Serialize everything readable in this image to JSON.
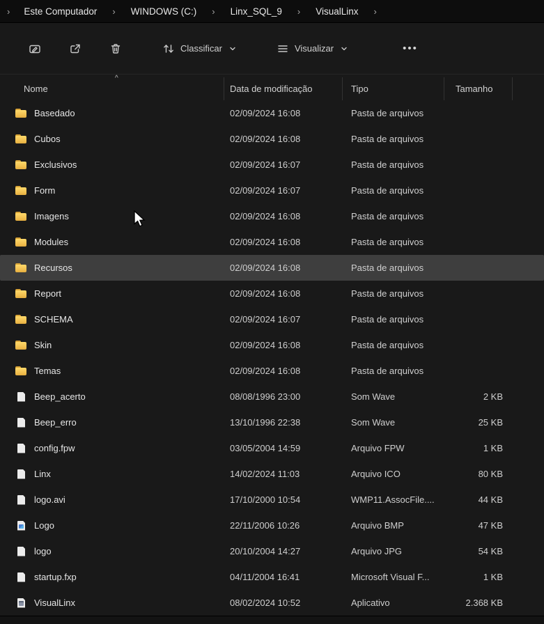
{
  "breadcrumb": {
    "separator": "›",
    "items": [
      "Este Computador",
      "WINDOWS (C:)",
      "Linx_SQL_9",
      "VisualLinx"
    ]
  },
  "toolbar": {
    "sort_label": "Classificar",
    "view_label": "Visualizar",
    "more_label": "•••"
  },
  "columns": {
    "name": "Nome",
    "date": "Data de modificação",
    "type": "Tipo",
    "size": "Tamanho",
    "sort_indicator": "^"
  },
  "files": [
    {
      "name": "Basedado",
      "date": "02/09/2024 16:08",
      "type": "Pasta de arquivos",
      "size": "",
      "kind": "folder",
      "selected": false
    },
    {
      "name": "Cubos",
      "date": "02/09/2024 16:08",
      "type": "Pasta de arquivos",
      "size": "",
      "kind": "folder",
      "selected": false
    },
    {
      "name": "Exclusivos",
      "date": "02/09/2024 16:07",
      "type": "Pasta de arquivos",
      "size": "",
      "kind": "folder",
      "selected": false
    },
    {
      "name": "Form",
      "date": "02/09/2024 16:07",
      "type": "Pasta de arquivos",
      "size": "",
      "kind": "folder",
      "selected": false
    },
    {
      "name": "Imagens",
      "date": "02/09/2024 16:08",
      "type": "Pasta de arquivos",
      "size": "",
      "kind": "folder",
      "selected": false
    },
    {
      "name": "Modules",
      "date": "02/09/2024 16:08",
      "type": "Pasta de arquivos",
      "size": "",
      "kind": "folder",
      "selected": false
    },
    {
      "name": "Recursos",
      "date": "02/09/2024 16:08",
      "type": "Pasta de arquivos",
      "size": "",
      "kind": "folder",
      "selected": true
    },
    {
      "name": "Report",
      "date": "02/09/2024 16:08",
      "type": "Pasta de arquivos",
      "size": "",
      "kind": "folder",
      "selected": false
    },
    {
      "name": "SCHEMA",
      "date": "02/09/2024 16:07",
      "type": "Pasta de arquivos",
      "size": "",
      "kind": "folder",
      "selected": false
    },
    {
      "name": "Skin",
      "date": "02/09/2024 16:08",
      "type": "Pasta de arquivos",
      "size": "",
      "kind": "folder",
      "selected": false
    },
    {
      "name": "Temas",
      "date": "02/09/2024 16:08",
      "type": "Pasta de arquivos",
      "size": "",
      "kind": "folder",
      "selected": false
    },
    {
      "name": "Beep_acerto",
      "date": "08/08/1996 23:00",
      "type": "Som Wave",
      "size": "2 KB",
      "kind": "file",
      "selected": false
    },
    {
      "name": "Beep_erro",
      "date": "13/10/1996 22:38",
      "type": "Som Wave",
      "size": "25 KB",
      "kind": "file",
      "selected": false
    },
    {
      "name": "config.fpw",
      "date": "03/05/2004 14:59",
      "type": "Arquivo FPW",
      "size": "1 KB",
      "kind": "file",
      "selected": false
    },
    {
      "name": "Linx",
      "date": "14/02/2024 11:03",
      "type": "Arquivo ICO",
      "size": "80 KB",
      "kind": "file",
      "selected": false
    },
    {
      "name": "logo.avi",
      "date": "17/10/2000 10:54",
      "type": "WMP11.AssocFile....",
      "size": "44 KB",
      "kind": "file",
      "selected": false
    },
    {
      "name": "Logo",
      "date": "22/11/2006 10:26",
      "type": "Arquivo BMP",
      "size": "47 KB",
      "kind": "image",
      "selected": false
    },
    {
      "name": "logo",
      "date": "20/10/2004 14:27",
      "type": "Arquivo JPG",
      "size": "54 KB",
      "kind": "file",
      "selected": false
    },
    {
      "name": "startup.fxp",
      "date": "04/11/2004 16:41",
      "type": "Microsoft Visual F...",
      "size": "1 KB",
      "kind": "file",
      "selected": false
    },
    {
      "name": "VisualLinx",
      "date": "08/02/2024 10:52",
      "type": "Aplicativo",
      "size": "2.368 KB",
      "kind": "app",
      "selected": false
    }
  ]
}
